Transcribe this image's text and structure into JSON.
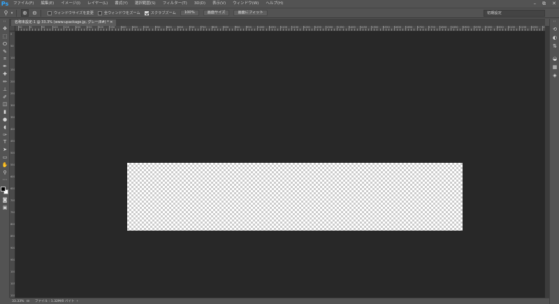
{
  "app": {
    "logo": "Ps",
    "menu": [
      "ファイル(F)",
      "編集(E)",
      "イメージ(I)",
      "レイヤー(L)",
      "書式(Y)",
      "選択範囲(S)",
      "フィルター(T)",
      "3D(D)",
      "表示(V)",
      "ウィンドウ(W)",
      "ヘルプ(H)"
    ],
    "window_controls": [
      "–",
      "⧉",
      "✕"
    ]
  },
  "options": {
    "tool_icon": "zoom-icon",
    "resize_windows_label": "ウィンドウサイズを変更",
    "resize_windows_checked": false,
    "zoom_all_label": "全ウィンドウをズーム",
    "zoom_all_checked": false,
    "scrubby_zoom_label": "スクラブズーム",
    "scrubby_zoom_checked": true,
    "btn_100": "100%",
    "btn_fit_screen": "画面サイズ",
    "btn_fill_screen": "画面にフィット",
    "workspace": "初期設定"
  },
  "document": {
    "tab_title": "名称未設定-1 @ 33.3% (www.upackage.jp, グレー/8#) * ✕",
    "zoom": "33.33%",
    "file_info": "ファイル : 1.32M/0 バイト"
  },
  "ruler": {
    "h_labels": [
      "50",
      "0",
      "50",
      "100",
      "150",
      "200",
      "250",
      "300",
      "350",
      "400",
      "450",
      "500",
      "550",
      "600",
      "650",
      "700",
      "750",
      "800",
      "850",
      "900",
      "950",
      "1000",
      "1050",
      "1100",
      "1150",
      "1200",
      "1250",
      "1300",
      "1350",
      "1400",
      "1450",
      "1500",
      "1550",
      "1600",
      "1650",
      "1700",
      "1750",
      "1800",
      "1850",
      "1900",
      "1950",
      "2000",
      "2050",
      "2100",
      "2150",
      "2200",
      "2250",
      "2300"
    ],
    "v_labels": [
      "0",
      "50",
      "100",
      "150",
      "200",
      "250",
      "300",
      "350",
      "400",
      "450",
      "500",
      "550",
      "600",
      "650",
      "700",
      "750",
      "800",
      "850",
      "900",
      "950",
      "1000",
      "1050",
      "1100"
    ]
  },
  "tools": [
    "move-icon",
    "marquee-icon",
    "lasso-icon",
    "quick-select-icon",
    "crop-icon",
    "eyedropper-icon",
    "healing-brush-icon",
    "brush-icon",
    "clone-stamp-icon",
    "history-brush-icon",
    "eraser-icon",
    "gradient-icon",
    "blur-icon",
    "dodge-icon",
    "pen-icon",
    "type-icon",
    "path-select-icon",
    "rectangle-icon",
    "hand-icon",
    "zoom-tool-icon",
    "more-tools-icon"
  ],
  "tool_glyphs": [
    "✥",
    "⬚",
    "ⵔ",
    "✎",
    "⌗",
    "✒",
    "✚",
    "✏",
    "⊥",
    "✐",
    "◫",
    "▮",
    "●",
    "◖",
    "✑",
    "T",
    "➤",
    "▭",
    "✋",
    "⚲",
    "⋯"
  ],
  "dock": [
    {
      "name": "history-icon",
      "glyph": "⟲"
    },
    {
      "name": "color-icon",
      "glyph": "◐"
    },
    {
      "name": "adjustments-icon",
      "glyph": "⇅"
    },
    {
      "name": "layers-3d-icon",
      "glyph": "◒"
    },
    {
      "name": "channels-icon",
      "glyph": "▦"
    },
    {
      "name": "layers-icon",
      "glyph": "◈"
    }
  ]
}
